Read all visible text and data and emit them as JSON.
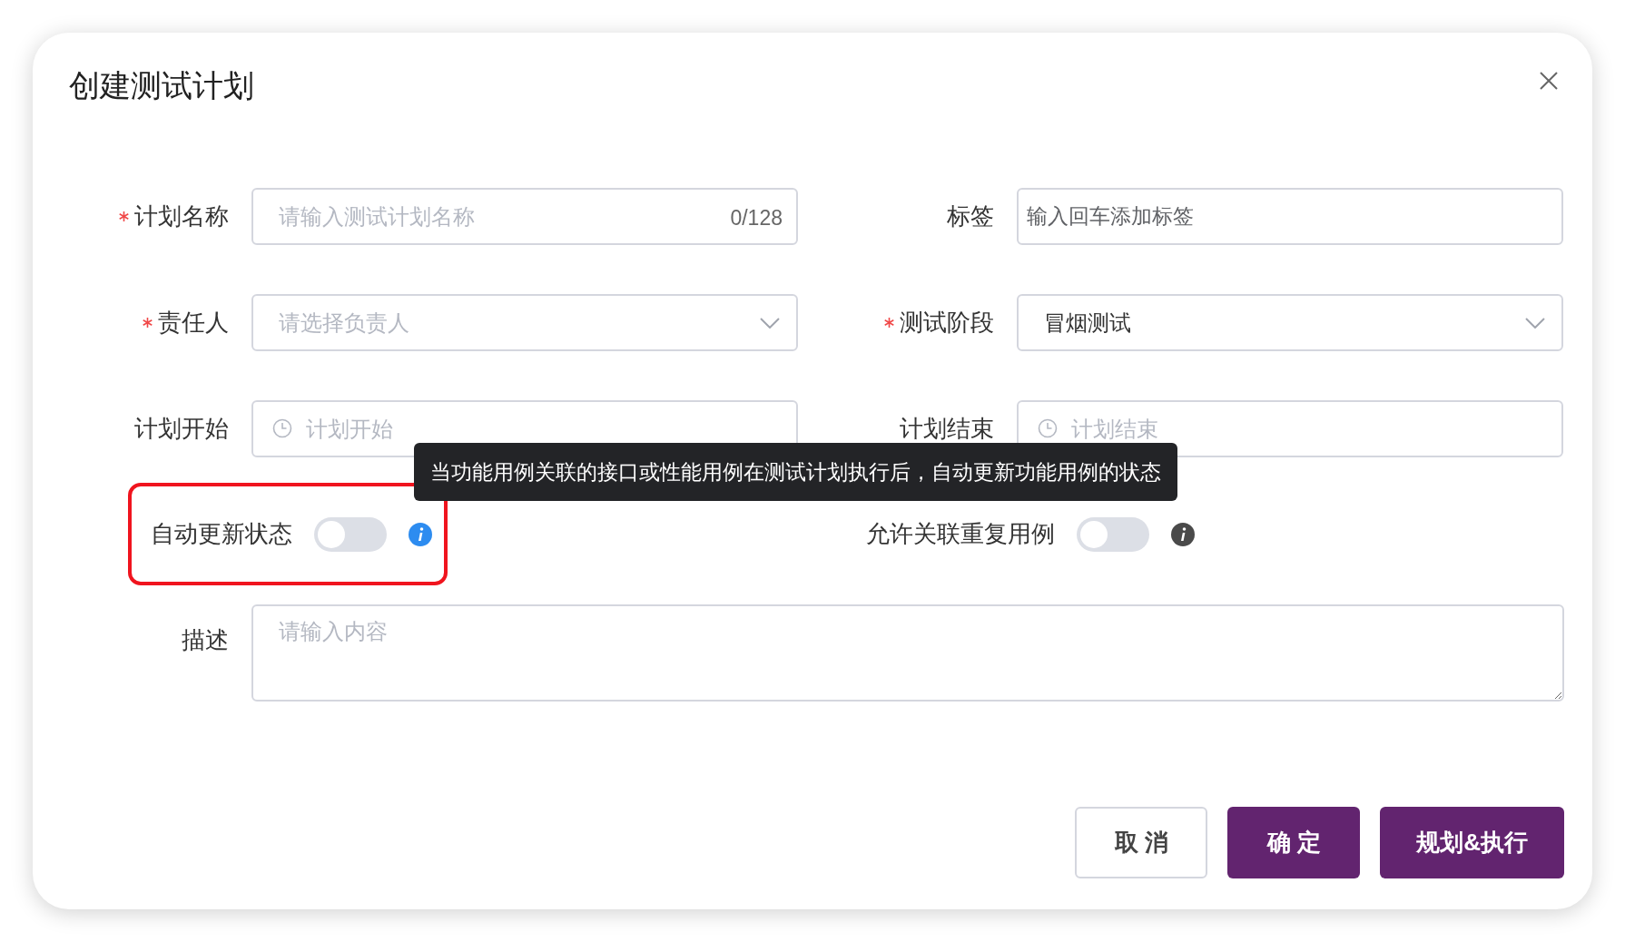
{
  "dialog": {
    "title": "创建测试计划"
  },
  "fields": [
    {
      "kind": "text",
      "label": "计划名称",
      "required": true,
      "placeholder": "请输入测试计划名称",
      "counter": "0/128"
    },
    {
      "kind": "tags",
      "label": "标签",
      "required": false,
      "placeholder": "输入回车添加标签"
    },
    {
      "kind": "select",
      "label": "责任人",
      "required": true,
      "placeholder": "请选择负责人"
    },
    {
      "kind": "select",
      "label": "测试阶段",
      "required": true,
      "value": "冒烟测试"
    },
    {
      "kind": "date",
      "label": "计划开始",
      "required": false,
      "placeholder": "计划开始"
    },
    {
      "kind": "date",
      "label": "计划结束",
      "required": false,
      "placeholder": "计划结束"
    }
  ],
  "switches": [
    {
      "label": "自动更新状态",
      "on": false,
      "highlighted": true,
      "info_active": true
    },
    {
      "label": "允许关联重复用例",
      "on": false,
      "highlighted": false,
      "info_active": false
    }
  ],
  "tooltip": {
    "text": "当功能用例关联的接口或性能用例在测试计划执行后，自动更新功能用例的状态"
  },
  "description": {
    "label": "描述",
    "placeholder": "请输入内容"
  },
  "buttons": [
    {
      "label": "取 消",
      "kind": "default"
    },
    {
      "label": "确 定",
      "kind": "primary"
    },
    {
      "label": "规划&执行",
      "kind": "primary"
    }
  ]
}
